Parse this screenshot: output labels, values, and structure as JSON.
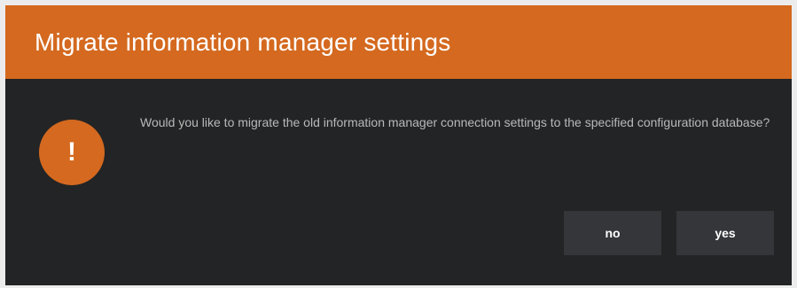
{
  "dialog": {
    "title": "Migrate information manager settings",
    "icon": "exclamation-icon",
    "icon_glyph": "!",
    "message": "Would you like to migrate the old information manager connection settings to the specified configuration database?",
    "buttons": {
      "no_label": "no",
      "yes_label": "yes"
    }
  },
  "colors": {
    "accent": "#d4691f",
    "background": "#232425",
    "button": "#34363a",
    "message_text": "#b9b9b9"
  }
}
